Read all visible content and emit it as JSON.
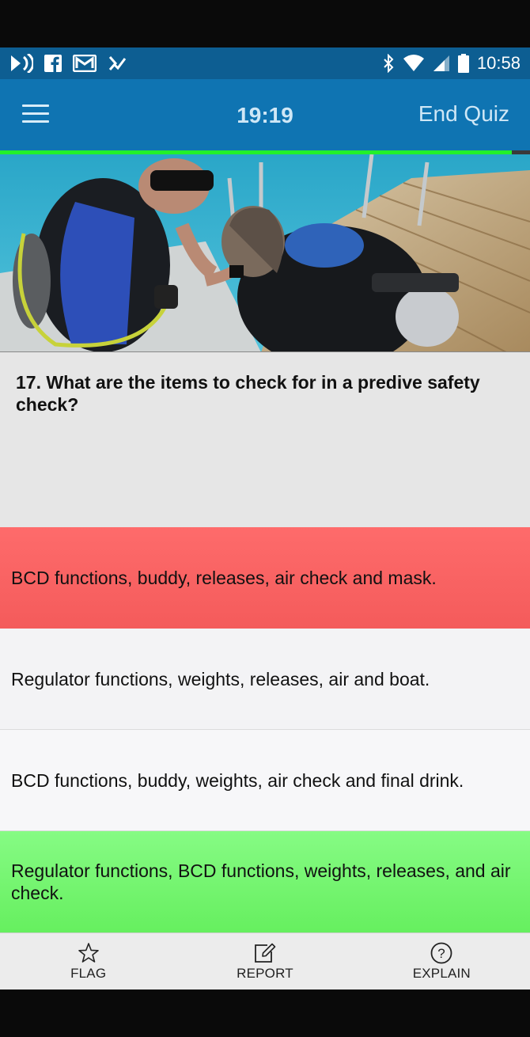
{
  "status_bar": {
    "time": "10:58",
    "icons": [
      "cast-icon",
      "facebook-icon",
      "gmail-icon",
      "task-check-icon",
      "bluetooth-icon",
      "wifi-icon",
      "signal-icon",
      "battery-icon"
    ]
  },
  "app_bar": {
    "menu_icon": "hamburger-icon",
    "timer": "19:19",
    "end_quiz_label": "End Quiz"
  },
  "progress": {
    "fraction": 0.965,
    "fill_color": "#22f02a"
  },
  "question": {
    "text": "17. What are the items to check for in a predive safety check?"
  },
  "answers": [
    {
      "text": "BCD functions, buddy, releases, air check and mask.",
      "state": "incorrect",
      "color": "#f45b5b"
    },
    {
      "text": "Regulator functions, weights, releases, air and boat.",
      "state": "neutral"
    },
    {
      "text": "BCD functions, buddy, weights, air check and final drink.",
      "state": "neutral"
    },
    {
      "text": "Regulator functions, BCD functions, weights, releases, and air check.",
      "state": "correct",
      "color": "#66ef5f"
    }
  ],
  "bottom_bar": {
    "flag_label": "FLAG",
    "report_label": "REPORT",
    "explain_label": "EXPLAIN",
    "flag_icon": "star-outline-icon",
    "report_icon": "edit-icon",
    "explain_icon": "question-circle-icon"
  },
  "colors": {
    "status_bar": "#0d5e92",
    "app_bar": "#0f74b2",
    "question_bg": "#e6e6e6"
  }
}
